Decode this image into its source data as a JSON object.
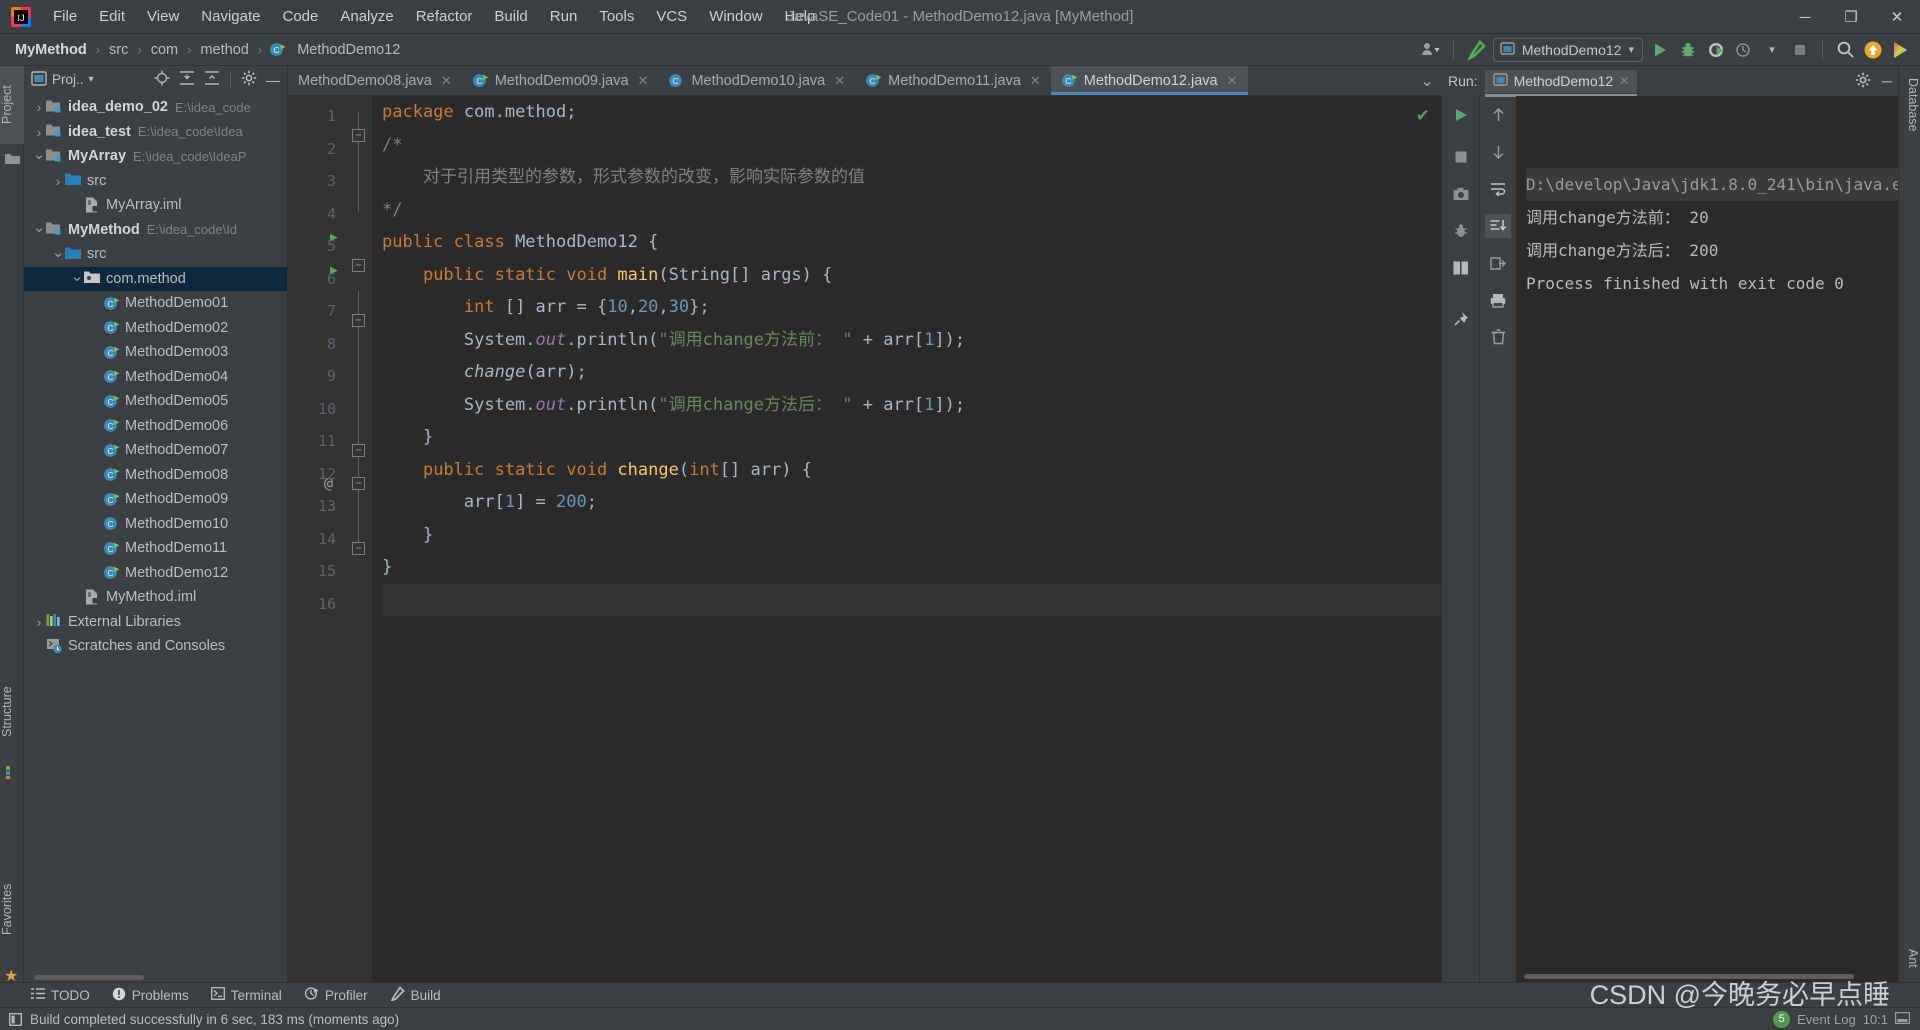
{
  "titlebar": {
    "window_title": "JavaSE_Code01 - MethodDemo12.java [MyMethod]",
    "menus": [
      {
        "label": "File"
      },
      {
        "label": "Edit"
      },
      {
        "label": "View"
      },
      {
        "label": "Navigate"
      },
      {
        "label": "Code"
      },
      {
        "label": "Analyze"
      },
      {
        "label": "Refactor"
      },
      {
        "label": "Build"
      },
      {
        "label": "Run"
      },
      {
        "label": "Tools"
      },
      {
        "label": "VCS"
      },
      {
        "label": "Window"
      },
      {
        "label": "Help"
      }
    ],
    "minimize": "─",
    "maximize": "❐",
    "close": "✕"
  },
  "navbar": {
    "breadcrumbs": [
      "MyMethod",
      "src",
      "com",
      "method",
      "MethodDemo12"
    ],
    "separator": "›",
    "run_config": "MethodDemo12",
    "dropdown_caret": "▾"
  },
  "left_strip": {
    "project_label": "Project",
    "structure_label": "Structure",
    "favorites_label": "Favorites"
  },
  "right_strip": {
    "database_label": "Database",
    "ant_label": "Ant"
  },
  "project_panel": {
    "title": "Proj..",
    "tree": [
      {
        "indent": 0,
        "arrow": "›",
        "icon": "module-icon",
        "label": "idea_demo_02",
        "bold": true,
        "path": "E:\\idea_code",
        "selected": false
      },
      {
        "indent": 0,
        "arrow": "›",
        "icon": "module-icon",
        "label": "idea_test",
        "bold": true,
        "path": "E:\\idea_code\\Idea",
        "selected": false
      },
      {
        "indent": 0,
        "arrow": "⌄",
        "icon": "module-icon",
        "label": "MyArray",
        "bold": true,
        "path": "E:\\idea_code\\IdeaP",
        "selected": false
      },
      {
        "indent": 1,
        "arrow": "›",
        "icon": "source-folder-icon",
        "label": "src",
        "bold": false,
        "path": "",
        "selected": false
      },
      {
        "indent": 2,
        "arrow": "",
        "icon": "iml-file-icon",
        "label": "MyArray.iml",
        "bold": false,
        "path": "",
        "selected": false
      },
      {
        "indent": 0,
        "arrow": "⌄",
        "icon": "module-icon",
        "label": "MyMethod",
        "bold": true,
        "path": "E:\\idea_code\\Id",
        "selected": false
      },
      {
        "indent": 1,
        "arrow": "⌄",
        "icon": "source-folder-icon",
        "label": "src",
        "bold": false,
        "path": "",
        "selected": false
      },
      {
        "indent": 2,
        "arrow": "⌄",
        "icon": "package-icon",
        "label": "com.method",
        "bold": false,
        "path": "",
        "selected": true
      },
      {
        "indent": 3,
        "arrow": "",
        "icon": "java-class-run-icon",
        "label": "MethodDemo01",
        "bold": false,
        "path": "",
        "selected": false
      },
      {
        "indent": 3,
        "arrow": "",
        "icon": "java-class-run-icon",
        "label": "MethodDemo02",
        "bold": false,
        "path": "",
        "selected": false
      },
      {
        "indent": 3,
        "arrow": "",
        "icon": "java-class-run-icon",
        "label": "MethodDemo03",
        "bold": false,
        "path": "",
        "selected": false
      },
      {
        "indent": 3,
        "arrow": "",
        "icon": "java-class-run-icon",
        "label": "MethodDemo04",
        "bold": false,
        "path": "",
        "selected": false
      },
      {
        "indent": 3,
        "arrow": "",
        "icon": "java-class-run-icon",
        "label": "MethodDemo05",
        "bold": false,
        "path": "",
        "selected": false
      },
      {
        "indent": 3,
        "arrow": "",
        "icon": "java-class-run-icon",
        "label": "MethodDemo06",
        "bold": false,
        "path": "",
        "selected": false
      },
      {
        "indent": 3,
        "arrow": "",
        "icon": "java-class-run-icon",
        "label": "MethodDemo07",
        "bold": false,
        "path": "",
        "selected": false
      },
      {
        "indent": 3,
        "arrow": "",
        "icon": "java-class-run-icon",
        "label": "MethodDemo08",
        "bold": false,
        "path": "",
        "selected": false
      },
      {
        "indent": 3,
        "arrow": "",
        "icon": "java-class-run-icon",
        "label": "MethodDemo09",
        "bold": false,
        "path": "",
        "selected": false
      },
      {
        "indent": 3,
        "arrow": "",
        "icon": "java-class-icon",
        "label": "MethodDemo10",
        "bold": false,
        "path": "",
        "selected": false
      },
      {
        "indent": 3,
        "arrow": "",
        "icon": "java-class-run-icon",
        "label": "MethodDemo11",
        "bold": false,
        "path": "",
        "selected": false
      },
      {
        "indent": 3,
        "arrow": "",
        "icon": "java-class-run-icon",
        "label": "MethodDemo12",
        "bold": false,
        "path": "",
        "selected": false
      },
      {
        "indent": 2,
        "arrow": "",
        "icon": "iml-file-icon",
        "label": "MyMethod.iml",
        "bold": false,
        "path": "",
        "selected": false
      },
      {
        "indent": 0,
        "arrow": "›",
        "icon": "libraries-icon",
        "label": "External Libraries",
        "bold": false,
        "path": "",
        "selected": false
      },
      {
        "indent": 0,
        "arrow": "",
        "icon": "scratches-icon",
        "label": "Scratches and Consoles",
        "bold": false,
        "path": "",
        "selected": false
      }
    ]
  },
  "editor": {
    "tabs": [
      {
        "label": "MethodDemo08.java",
        "icon": "java-class-icon",
        "active": false,
        "show_icon": false
      },
      {
        "label": "MethodDemo09.java",
        "icon": "java-class-run-icon",
        "active": false,
        "show_icon": true
      },
      {
        "label": "MethodDemo10.java",
        "icon": "java-class-icon",
        "active": false,
        "show_icon": true
      },
      {
        "label": "MethodDemo11.java",
        "icon": "java-class-run-icon",
        "active": false,
        "show_icon": true
      },
      {
        "label": "MethodDemo12.java",
        "icon": "java-class-run-icon",
        "active": true,
        "show_icon": true
      }
    ],
    "close_glyph": "✕",
    "more_glyph": "⌄",
    "inspection_ok": "✔",
    "line_numbers": [
      "1",
      "2",
      "3",
      "4",
      "5",
      "6",
      "7",
      "8",
      "9",
      "10",
      "11",
      "12",
      "13",
      "14",
      "15",
      "16"
    ],
    "annotation_marker": "@",
    "code_lines": [
      {
        "n": 1,
        "tokens": [
          {
            "t": "package ",
            "c": "kw"
          },
          {
            "t": "com.method;",
            "c": "typ"
          }
        ]
      },
      {
        "n": 2,
        "tokens": [
          {
            "t": "/*",
            "c": "cmt"
          }
        ]
      },
      {
        "n": 3,
        "tokens": [
          {
            "t": "    对于引用类型的参数，形式参数的改变，影响实际参数的值",
            "c": "cmt"
          }
        ]
      },
      {
        "n": 4,
        "tokens": [
          {
            "t": "*/",
            "c": "cmt"
          }
        ]
      },
      {
        "n": 5,
        "tokens": [
          {
            "t": "public class ",
            "c": "kw"
          },
          {
            "t": "MethodDemo12 {",
            "c": "typ"
          }
        ]
      },
      {
        "n": 6,
        "tokens": [
          {
            "t": "    ",
            "c": "typ"
          },
          {
            "t": "public static void ",
            "c": "kw"
          },
          {
            "t": "main",
            "c": "meth"
          },
          {
            "t": "(String[] args) {",
            "c": "typ"
          }
        ]
      },
      {
        "n": 7,
        "tokens": [
          {
            "t": "        ",
            "c": "typ"
          },
          {
            "t": "int",
            "c": "kw"
          },
          {
            "t": " [] arr = {",
            "c": "typ"
          },
          {
            "t": "10",
            "c": "num"
          },
          {
            "t": ",",
            "c": "typ"
          },
          {
            "t": "20",
            "c": "num"
          },
          {
            "t": ",",
            "c": "typ"
          },
          {
            "t": "30",
            "c": "num"
          },
          {
            "t": "};",
            "c": "typ"
          }
        ]
      },
      {
        "n": 8,
        "tokens": [
          {
            "t": "        System.",
            "c": "typ"
          },
          {
            "t": "out",
            "c": "field"
          },
          {
            "t": ".println(",
            "c": "typ"
          },
          {
            "t": "\"调用change方法前： \"",
            "c": "str"
          },
          {
            "t": " + arr[",
            "c": "typ"
          },
          {
            "t": "1",
            "c": "num"
          },
          {
            "t": "]);",
            "c": "typ"
          }
        ]
      },
      {
        "n": 9,
        "tokens": [
          {
            "t": "        ",
            "c": "typ"
          },
          {
            "t": "change",
            "c": "mcall"
          },
          {
            "t": "(arr);",
            "c": "typ"
          }
        ]
      },
      {
        "n": 10,
        "tokens": [
          {
            "t": "        System.",
            "c": "typ"
          },
          {
            "t": "out",
            "c": "field"
          },
          {
            "t": ".println(",
            "c": "typ"
          },
          {
            "t": "\"调用change方法后： \"",
            "c": "str"
          },
          {
            "t": " + arr[",
            "c": "typ"
          },
          {
            "t": "1",
            "c": "num"
          },
          {
            "t": "]);",
            "c": "typ"
          }
        ]
      },
      {
        "n": 11,
        "tokens": [
          {
            "t": "    }",
            "c": "typ"
          }
        ]
      },
      {
        "n": 12,
        "tokens": [
          {
            "t": "    ",
            "c": "typ"
          },
          {
            "t": "public static void ",
            "c": "kw"
          },
          {
            "t": "change",
            "c": "meth"
          },
          {
            "t": "(",
            "c": "typ"
          },
          {
            "t": "int",
            "c": "kw"
          },
          {
            "t": "[] arr) {",
            "c": "typ"
          }
        ]
      },
      {
        "n": 13,
        "tokens": [
          {
            "t": "        arr[",
            "c": "typ"
          },
          {
            "t": "1",
            "c": "num"
          },
          {
            "t": "] = ",
            "c": "typ"
          },
          {
            "t": "200",
            "c": "num"
          },
          {
            "t": ";",
            "c": "typ"
          }
        ]
      },
      {
        "n": 14,
        "tokens": [
          {
            "t": "    }",
            "c": "typ"
          }
        ]
      },
      {
        "n": 15,
        "tokens": [
          {
            "t": "}",
            "c": "typ"
          }
        ]
      },
      {
        "n": 16,
        "tokens": [
          {
            "t": "",
            "c": "typ"
          }
        ]
      }
    ]
  },
  "run_panel": {
    "label": "Run:",
    "config_name": "MethodDemo12",
    "close_glyph": "✕",
    "settings_glyph": "⚙",
    "minimize_glyph": "─",
    "left_buttons": [
      "run-icon",
      "stop-icon",
      "camera-icon",
      "bug-icon",
      "grid-icon",
      "pin-icon"
    ],
    "right_buttons": [
      "scroll-up-icon",
      "scroll-down-icon",
      "soft-wrap-icon",
      "scroll-to-end-icon",
      "export-icon",
      "print-icon",
      "trash-icon"
    ],
    "console": [
      {
        "text": "D:\\develop\\Java\\jdk1.8.0_241\\bin\\java.e",
        "highlight": true
      },
      {
        "text": "调用change方法前： 20",
        "highlight": false
      },
      {
        "text": "调用change方法后： 200",
        "highlight": false
      },
      {
        "text": "",
        "highlight": false
      },
      {
        "text": "Process finished with exit code 0",
        "highlight": false
      }
    ]
  },
  "bottom_bar": {
    "items": [
      {
        "label": "TODO",
        "icon": "todo-icon"
      },
      {
        "label": "Problems",
        "icon": "problems-icon"
      },
      {
        "label": "Terminal",
        "icon": "terminal-icon"
      },
      {
        "label": "Profiler",
        "icon": "profiler-icon"
      },
      {
        "label": "Build",
        "icon": "build-icon"
      }
    ]
  },
  "status_bar": {
    "message": "Build completed successfully in 6 sec, 183 ms (moments ago)",
    "event_log_label": "Event Log",
    "event_log_count": "5",
    "time": "10:1"
  },
  "watermark": {
    "text": "CSDN @今晚务必早点睡"
  },
  "colors": {
    "chrome_bg": "#3c3f41",
    "editor_bg": "#2b2b2b",
    "gutter_bg": "#313335",
    "selection_blue": "#0d293e",
    "tab_active_underline": "#4a88c7",
    "keyword_orange": "#cc7832",
    "string_green": "#6a8759",
    "number_blue": "#6897bb",
    "method_yellow": "#ffc66d",
    "field_purple": "#9876aa",
    "comment_gray": "#808080",
    "run_green": "#4caf50"
  }
}
